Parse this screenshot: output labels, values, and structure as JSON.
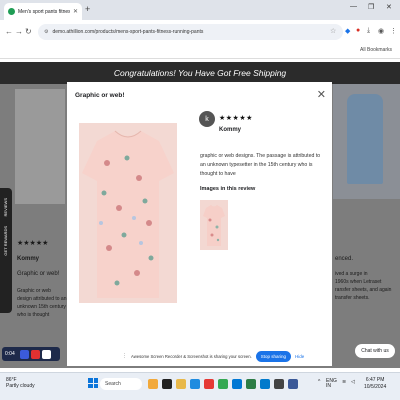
{
  "browser": {
    "tab_title": "Men's sport pants fitness runnin",
    "url": "demo.athillion.com/products/mens-sport-pants-fitness-running-pants",
    "bookmarks_label": "All Bookmarks"
  },
  "page": {
    "banner": "Congratulations! You Have Got Free Shipping",
    "bg_stars": "★★★★★",
    "bg_reviewer": "Kommy",
    "bg_title": "Graphic or web!",
    "bg_text": "Graphic or web design attributed to an unknown 15th century who is thought",
    "bg_right_1": "enced.",
    "bg_right_2": "ived a surge in\n1960s when Letraset\nransfer sheets, and again\ntransfer sheets.",
    "side_tab_1": "REVIEWS",
    "side_tab_2": "GET REWARDS"
  },
  "modal": {
    "title": "Graphic or web!",
    "avatar_letter": "k",
    "stars": "★★★★★",
    "reviewer": "Kommy",
    "review_text": "graphic or web designs. The passage is attributed to an unknown typesetter in the 15th century who is thought to have",
    "images_label": "Images in this review"
  },
  "recorder": {
    "time": "0:04"
  },
  "share_bar": {
    "message": "Awesome Screen Recorder & Screenshot is sharing your screen.",
    "stop_label": "Stop sharing",
    "hide_label": "Hide"
  },
  "chat_label": "Chat with us",
  "taskbar": {
    "temp": "86°F",
    "weather": "Partly cloudy",
    "search_placeholder": "Search",
    "lang": "ENG",
    "region": "IN",
    "time": "6:47 PM",
    "date": "10/5/2024"
  },
  "colors": {
    "banner": "#2b2b2b",
    "stop_button": "#1a73e8",
    "overlay": "#7d7d7d"
  }
}
